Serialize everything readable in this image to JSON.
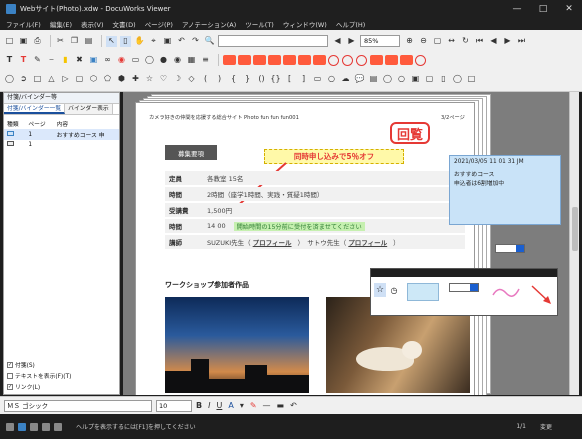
{
  "window": {
    "title": "Webサイト(Photo).xdw - DocuWorks Viewer"
  },
  "menu": [
    "ファイル(F)",
    "編集(E)",
    "表示(V)",
    "文書(D)",
    "ページ(P)",
    "アノテーション(A)",
    "ツール(T)",
    "ウィンドウ(W)",
    "ヘルプ(H)"
  ],
  "toolbar": {
    "zoom": "85%"
  },
  "sidepanel": {
    "title": "付箋/バインダー等",
    "tabs": [
      "付箋/バインダー一覧",
      "バインダー表示"
    ],
    "columns": [
      "種類",
      "ページ",
      "内容"
    ],
    "rows": [
      {
        "page": "1",
        "content": "おすすめコース 申"
      },
      {
        "page": "1",
        "content": ""
      }
    ],
    "checks": [
      "付箋(S)",
      "テキストを表示(F)(T)",
      "リンク(L)"
    ]
  },
  "document": {
    "header": "カメラ好きの仲間を応援する総合サイト Photo fun fun fun001",
    "page_ref": "3/2ページ",
    "stamp": "回覧",
    "section_tag": "募集要項",
    "callout": "同時申し込みで5％オフ",
    "rows": [
      {
        "label": "定員",
        "value": "各教室 15名"
      },
      {
        "label": "時間",
        "value": "2時間（座学1時間、実践・質疑1時間）"
      },
      {
        "label": "受講費",
        "value": "1,500円"
      },
      {
        "label": "時間",
        "value": "14 00",
        "note": "開始時間の15分前に受付を済ませてください"
      },
      {
        "label": "講師",
        "value": "SUZUKI先生（",
        "link1": "プロフィール",
        "value2": "）　サトウ先生（",
        "link2": "プロフィール",
        "value3": "）"
      }
    ],
    "workshop_title": "ワークショップ参加者作品"
  },
  "sticky_note": {
    "meta": "2021/03/05  11 01 31  JM",
    "lines": [
      "おすすめコース",
      "申込者は6割増加中"
    ]
  },
  "fontbar": {
    "font": "ＭＳ ゴシック",
    "size": "10"
  },
  "status": {
    "text": "ヘルプを表示するには[F1]を押してください",
    "page": "1/1",
    "mode": "変更"
  },
  "colors": {
    "accent_blue": "#1a4f9c",
    "stamp_red": "#e53935",
    "sticky_blue": "#c9e3f8",
    "callout_yellow": "#fff9a8"
  }
}
